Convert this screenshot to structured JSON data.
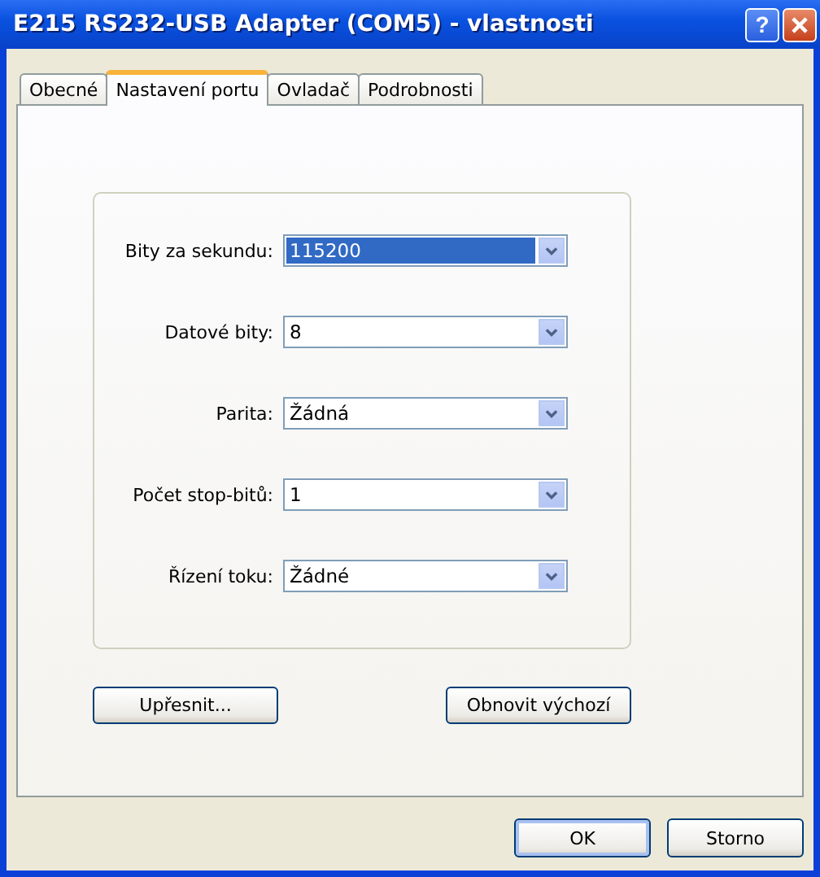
{
  "window": {
    "title": "E215 RS232-USB Adapter (COM5)  - vlastnosti",
    "help_button": "?"
  },
  "tabs": [
    {
      "label": "Obecné",
      "selected": false
    },
    {
      "label": "Nastavení portu",
      "selected": true
    },
    {
      "label": "Ovladač",
      "selected": false
    },
    {
      "label": "Podrobnosti",
      "selected": false
    }
  ],
  "settings": [
    {
      "label": "Bity za sekundu:",
      "value": "115200",
      "focused": true
    },
    {
      "label": "Datové bity:",
      "value": "8",
      "focused": false
    },
    {
      "label": "Parita:",
      "value": "Žádná",
      "focused": false
    },
    {
      "label": "Počet stop-bitů:",
      "value": "1",
      "focused": false
    },
    {
      "label": "Řízení toku:",
      "value": "Žádné",
      "focused": false
    }
  ],
  "panel_buttons": [
    "Upřesnit...",
    "Obnovit výchozí"
  ],
  "buttons": [
    "OK",
    "Storno"
  ]
}
